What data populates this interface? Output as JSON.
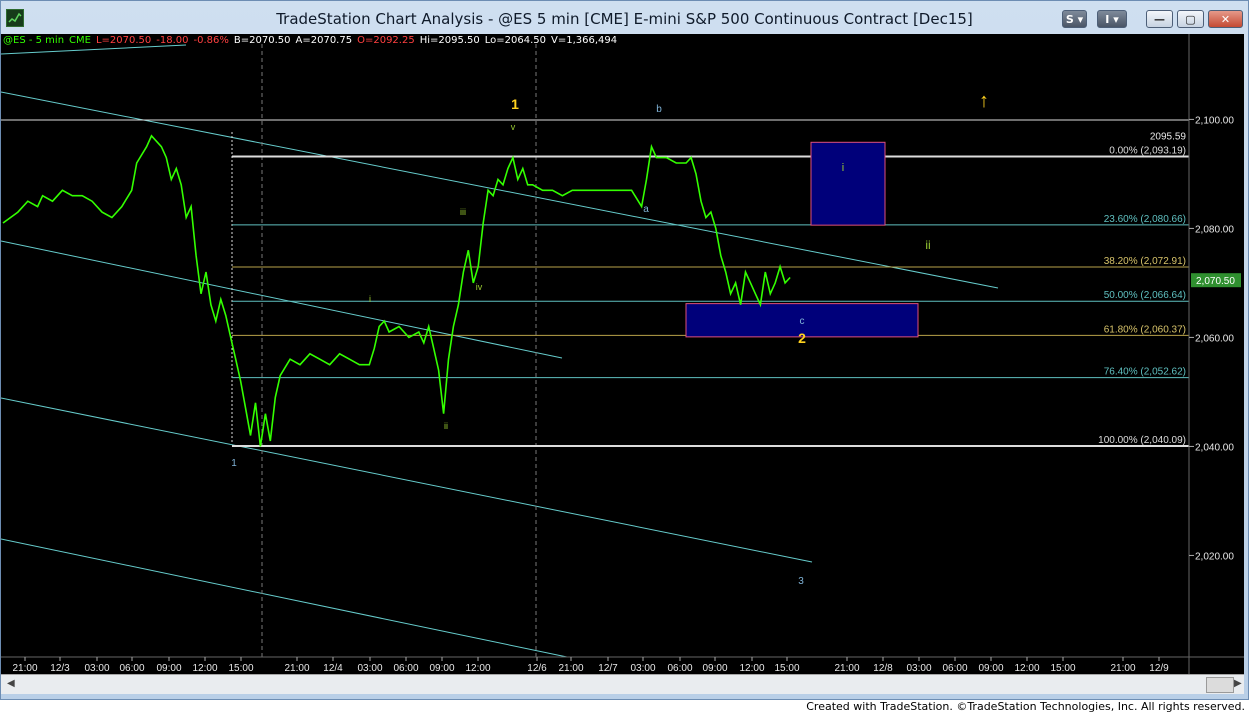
{
  "window": {
    "title": "TradeStation Chart Analysis - @ES 5 min [CME] E-mini S&P 500 Continuous Contract [Dec15]",
    "buttons": {
      "s": "S",
      "i": "I",
      "minimize": "—",
      "maximize": "▢",
      "close": "✕"
    }
  },
  "legend": {
    "symbol": "@ES - 5 min",
    "exchange": "CME",
    "last": "L=2070.50",
    "change": "-18.00",
    "change_pct": "-0.86%",
    "bid": "B=2070.50",
    "ask": "A=2070.75",
    "open": "O=2092.25",
    "high": "Hi=2095.50",
    "low": "Lo=2064.50",
    "volume": "V=1,366,494"
  },
  "colors": {
    "price": "#33ff00",
    "fib": "#5fc0c0",
    "channel": "#66cccc",
    "wave_major": "#ffd21e",
    "wave_minor_green": "#9acd32",
    "wave_minor_blue": "#7fb2d6",
    "box_fill": "#00007a",
    "box_border": "#e0507a"
  },
  "chart_data": {
    "type": "line",
    "title": "",
    "y_axis": {
      "ticks": [
        "2,100.00",
        "2,080.00",
        "2,060.00",
        "2,040.00",
        "2,020.00"
      ],
      "ylim": [
        2001,
        2112
      ]
    },
    "x_axis": {
      "ticks": [
        "21:00",
        "12/3",
        "03:00",
        "06:00",
        "09:00",
        "12:00",
        "15:00",
        "21:00",
        "12/4",
        "03:00",
        "06:00",
        "09:00",
        "12:00",
        "12/6",
        "21:00",
        "12/7",
        "03:00",
        "06:00",
        "09:00",
        "12:00",
        "15:00",
        "21:00",
        "12/8",
        "03:00",
        "06:00",
        "09:00",
        "12:00",
        "15:00",
        "21:00",
        "12/9"
      ]
    },
    "last_price_label": "2,070.50",
    "high_label": "2095.59",
    "series": [
      {
        "name": "@ES - 5 min",
        "points": [
          [
            0,
            2081
          ],
          [
            3,
            2083
          ],
          [
            5,
            2085
          ],
          [
            7,
            2084
          ],
          [
            8,
            2086
          ],
          [
            10,
            2085
          ],
          [
            12,
            2087
          ],
          [
            14,
            2086
          ],
          [
            16,
            2086
          ],
          [
            18,
            2085
          ],
          [
            20,
            2083
          ],
          [
            22,
            2082
          ],
          [
            24,
            2084
          ],
          [
            26,
            2087
          ],
          [
            27,
            2092
          ],
          [
            29,
            2095
          ],
          [
            30,
            2097
          ],
          [
            32,
            2095
          ],
          [
            33,
            2093
          ],
          [
            34,
            2089
          ],
          [
            35,
            2091
          ],
          [
            36,
            2088
          ],
          [
            37,
            2082
          ],
          [
            38,
            2084
          ],
          [
            39,
            2075
          ],
          [
            40,
            2068
          ],
          [
            41,
            2072
          ],
          [
            42,
            2066
          ],
          [
            43,
            2063
          ],
          [
            44,
            2067
          ],
          [
            45,
            2064
          ],
          [
            46,
            2060
          ],
          [
            47,
            2056
          ],
          [
            48,
            2052
          ],
          [
            49,
            2047
          ],
          [
            50,
            2042
          ],
          [
            51,
            2048
          ],
          [
            52,
            2040
          ],
          [
            53,
            2046
          ],
          [
            54,
            2041
          ],
          [
            55,
            2049
          ],
          [
            56,
            2053
          ],
          [
            58,
            2056
          ],
          [
            60,
            2055
          ],
          [
            62,
            2057
          ],
          [
            64,
            2056
          ],
          [
            66,
            2055
          ],
          [
            68,
            2057
          ],
          [
            70,
            2056
          ],
          [
            72,
            2055
          ],
          [
            74,
            2055
          ],
          [
            75,
            2058
          ],
          [
            76,
            2062
          ],
          [
            77,
            2063
          ],
          [
            78,
            2061
          ],
          [
            80,
            2062
          ],
          [
            82,
            2060
          ],
          [
            84,
            2061
          ],
          [
            85,
            2059
          ],
          [
            86,
            2062
          ],
          [
            87,
            2058
          ],
          [
            88,
            2054
          ],
          [
            89,
            2046
          ],
          [
            90,
            2056
          ],
          [
            91,
            2062
          ],
          [
            92,
            2066
          ],
          [
            93,
            2072
          ],
          [
            94,
            2076
          ],
          [
            95,
            2070
          ],
          [
            96,
            2073
          ],
          [
            97,
            2081
          ],
          [
            98,
            2087
          ],
          [
            99,
            2086
          ],
          [
            100,
            2089
          ],
          [
            101,
            2088
          ],
          [
            102,
            2091
          ],
          [
            103,
            2093
          ],
          [
            104,
            2089
          ],
          [
            105,
            2091
          ],
          [
            106,
            2088
          ],
          [
            107,
            2088
          ],
          [
            109,
            2087
          ],
          [
            111,
            2087
          ],
          [
            113,
            2086
          ],
          [
            115,
            2087
          ],
          [
            117,
            2087
          ],
          [
            119,
            2087
          ],
          [
            121,
            2087
          ],
          [
            123,
            2087
          ],
          [
            125,
            2087
          ],
          [
            127,
            2087
          ],
          [
            129,
            2084
          ],
          [
            130,
            2089
          ],
          [
            131,
            2095
          ],
          [
            132,
            2093
          ],
          [
            134,
            2093
          ],
          [
            136,
            2092
          ],
          [
            138,
            2092
          ],
          [
            139,
            2093
          ],
          [
            140,
            2090
          ],
          [
            141,
            2085
          ],
          [
            142,
            2082
          ],
          [
            143,
            2083
          ],
          [
            144,
            2080
          ],
          [
            145,
            2075
          ],
          [
            146,
            2072
          ],
          [
            147,
            2068
          ],
          [
            148,
            2070
          ],
          [
            149,
            2066
          ],
          [
            150,
            2072
          ],
          [
            151,
            2070
          ],
          [
            152,
            2068
          ],
          [
            153,
            2066
          ],
          [
            154,
            2072
          ],
          [
            155,
            2068
          ],
          [
            156,
            2070
          ],
          [
            157,
            2073
          ],
          [
            158,
            2070
          ],
          [
            159,
            2071
          ]
        ]
      }
    ],
    "fib_levels": [
      {
        "label": "0.00% (2,093.19)",
        "value": 2093.19
      },
      {
        "label": "23.60% (2,080.66)",
        "value": 2080.66
      },
      {
        "label": "38.20% (2,072.91)",
        "value": 2072.91
      },
      {
        "label": "50.00% (2,066.64)",
        "value": 2066.64
      },
      {
        "label": "61.80% (2,060.37)",
        "value": 2060.37
      },
      {
        "label": "76.40% (2,052.62)",
        "value": 2052.62
      },
      {
        "label": "100.00% (2,040.09)",
        "value": 2040.09
      }
    ],
    "wave_labels": [
      {
        "text": "1",
        "kind": "major"
      },
      {
        "text": "2",
        "kind": "major"
      },
      {
        "text": "↑",
        "kind": "major"
      },
      {
        "text": "v",
        "kind": "green"
      },
      {
        "text": "iii",
        "kind": "green"
      },
      {
        "text": "iv",
        "kind": "green"
      },
      {
        "text": "i",
        "kind": "green"
      },
      {
        "text": "ii",
        "kind": "green"
      },
      {
        "text": "ii",
        "kind": "green"
      },
      {
        "text": "i",
        "kind": "green"
      },
      {
        "text": "b",
        "kind": "blue"
      },
      {
        "text": "a",
        "kind": "blue"
      },
      {
        "text": "c",
        "kind": "blue"
      },
      {
        "text": "1",
        "kind": "blue"
      },
      {
        "text": "3",
        "kind": "blue"
      }
    ]
  },
  "footer": {
    "credit": "Created with TradeStation. ©TradeStation Technologies, Inc. All rights reserved."
  }
}
